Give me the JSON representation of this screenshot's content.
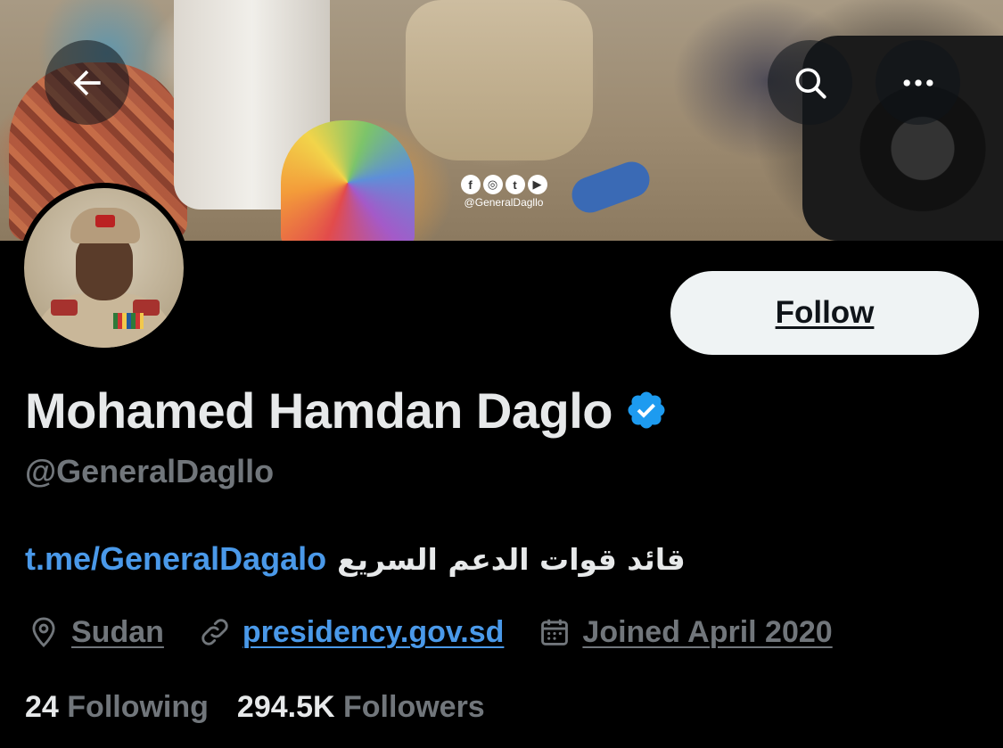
{
  "header": {
    "back_icon": "arrow-left-icon",
    "search_icon": "search-icon",
    "more_icon": "more-horizontal-icon"
  },
  "banner": {
    "watermark_icons": [
      "facebook-icon",
      "instagram-icon",
      "twitter-icon",
      "youtube-icon"
    ],
    "watermark_glyphs": [
      "f",
      "◎",
      "t",
      "▶"
    ],
    "watermark_handle": "@GeneralDagllo"
  },
  "profile": {
    "display_name": "Mohamed Hamdan Daglo",
    "verified": true,
    "handle": "@GeneralDagllo",
    "bio_link": "t.me/GeneralDagalo",
    "bio_text": "قائد قوات الدعم السريع",
    "location": "Sudan",
    "website": "presidency.gov.sd",
    "joined": "Joined April 2020"
  },
  "actions": {
    "follow_label": "Follow"
  },
  "stats": {
    "following_count": "24",
    "following_label": "Following",
    "followers_count": "294.5K",
    "followers_label": "Followers"
  },
  "colors": {
    "background": "#000000",
    "primary_text": "#e7e9ea",
    "secondary_text": "#71767b",
    "link": "#4a99e9",
    "verified": "#1d9bf0",
    "follow_button_bg": "#eff3f4"
  }
}
